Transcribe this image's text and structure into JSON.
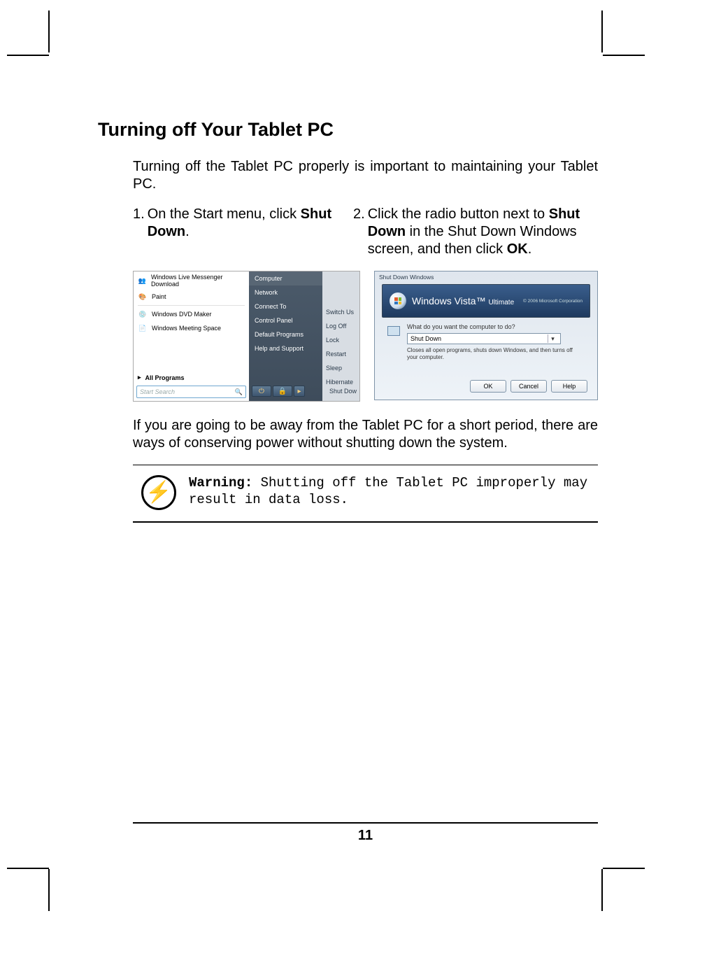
{
  "heading": "Turning off Your Tablet PC",
  "intro": "Turning off the Tablet PC properly is important to maintaining your Tablet PC.",
  "steps": [
    {
      "num": "1.",
      "pre": "On the Start menu, click ",
      "bold": "Shut Down",
      "post": "."
    },
    {
      "num": "2.",
      "pre": "Click the radio button next to ",
      "bold": "Shut Down",
      "mid": " in the Shut Down Windows screen, and then click ",
      "bold2": "OK",
      "post": "."
    }
  ],
  "startmenu": {
    "left_items": [
      "Windows Live Messenger Download",
      "Paint",
      "Windows DVD Maker",
      "Windows Meeting Space"
    ],
    "all_programs": "All Programs",
    "search_placeholder": "Start Search",
    "right_items": [
      "Computer",
      "Network",
      "Connect To",
      "Control Panel",
      "Default Programs",
      "Help and Support"
    ],
    "far_items": [
      "Switch Us",
      "Log Off",
      "Lock",
      "Restart",
      "Sleep",
      "Hibernate"
    ],
    "far_shutdown": "Shut Dow"
  },
  "shutdown_dialog": {
    "title": "Shut Down Windows",
    "brand_pre": "Windows Vista",
    "brand_edition": "Ultimate",
    "copyright": "© 2006 Microsoft Corporation",
    "question": "What do you want the computer to do?",
    "select_value": "Shut Down",
    "description": "Closes all open programs, shuts down Windows, and then turns off your computer.",
    "buttons": {
      "ok": "OK",
      "cancel": "Cancel",
      "help": "Help"
    }
  },
  "after": "If you are going to be away from the Tablet PC for a short period, there are ways of conserving power without shutting down the system.",
  "warning": {
    "label": "Warning:",
    "text": " Shutting off the Tablet PC improperly may result in data loss."
  },
  "page_number": "11"
}
